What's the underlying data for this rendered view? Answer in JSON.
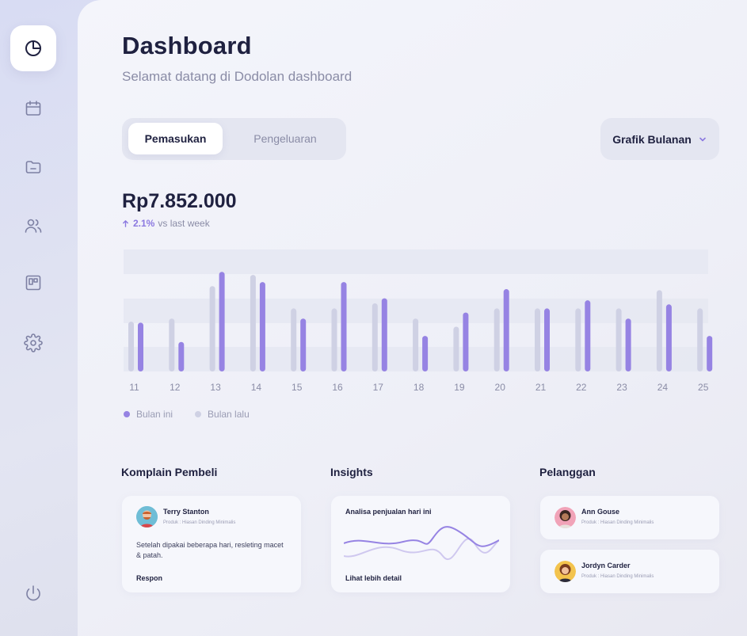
{
  "sidebar": {
    "items": [
      {
        "icon": "pie-chart-icon",
        "active": true
      },
      {
        "icon": "calendar-icon",
        "active": false
      },
      {
        "icon": "folder-icon",
        "active": false
      },
      {
        "icon": "users-icon",
        "active": false
      },
      {
        "icon": "board-icon",
        "active": false
      },
      {
        "icon": "gear-icon",
        "active": false
      }
    ],
    "logout_icon": "power-icon"
  },
  "header": {
    "title": "Dashboard",
    "subtitle": "Selamat datang di Dodolan dashboard"
  },
  "tabs": {
    "active": "Pemasukan",
    "inactive": "Pengeluaran"
  },
  "dropdown": {
    "label": "Grafik Bulanan"
  },
  "summary": {
    "amount": "Rp7.852.000",
    "delta_pct": "2.1%",
    "delta_text": "vs last week"
  },
  "colors": {
    "accent": "#9683e3",
    "previous": "#cfd1e4",
    "band": "#e6e8f2"
  },
  "chart_data": {
    "type": "bar",
    "categories": [
      "11",
      "12",
      "13",
      "14",
      "15",
      "16",
      "17",
      "18",
      "19",
      "20",
      "21",
      "22",
      "23",
      "24",
      "25"
    ],
    "series": [
      {
        "name": "Bulan ini",
        "values": [
          48,
          29,
          98,
          88,
          52,
          88,
          72,
          35,
          58,
          81,
          62,
          70,
          52,
          66,
          35
        ]
      },
      {
        "name": "Bulan lalu",
        "values": [
          49,
          52,
          84,
          95,
          62,
          62,
          67,
          52,
          44,
          62,
          62,
          62,
          62,
          80,
          62
        ]
      }
    ],
    "ylim": [
      0,
      120
    ],
    "xlabel": "",
    "ylabel": "",
    "legend": "bottom-left"
  },
  "sections": {
    "complaints": {
      "title": "Komplain Pembeli",
      "name": "Terry Stanton",
      "product": "Produk : Hiasan Dinding Minimalis",
      "message": "Setelah dipakai beberapa hari, resleting macet & patah.",
      "action": "Respon"
    },
    "insights": {
      "title": "Insights",
      "heading": "Analisa penjualan hari ini",
      "action": "Lihat lebih detail"
    },
    "customers": {
      "title": "Pelanggan",
      "items": [
        {
          "name": "Ann Gouse",
          "product": "Produk : Hiasan Dinding Minimalis"
        },
        {
          "name": "Jordyn Carder",
          "product": "Produk : Hiasan Dinding Minimalis"
        }
      ]
    }
  }
}
